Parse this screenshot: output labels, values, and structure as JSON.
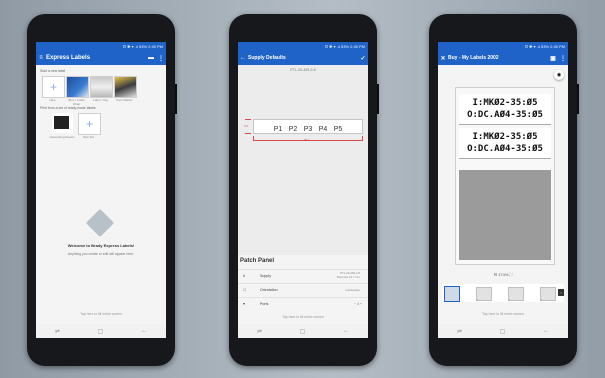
{
  "phone1": {
    "status": "⊡ ✱ ▾ .ıl 53% 2:45 PM",
    "title": "Express Labels",
    "start_new_label": "Start a new label",
    "templates": [
      "New",
      "Wire / Cable Wrap",
      "Label / Tag",
      "Pipe Marker"
    ],
    "print_from_set": "Print from a set of ready-made labels",
    "sets": [
      "Networking Panels",
      "New Set"
    ],
    "welcome_title": "Welcome to Brady Express Labels!",
    "welcome_body": "Anything you create or edit will appear here.",
    "footer_tip": "Tap here to fill entire screen"
  },
  "phone2": {
    "status": "⊡ ✱ ▾ .ıl 53% 2:45 PM",
    "title": "Supply Defaults",
    "part": "PTL-29-499-2-8",
    "patches": [
      "P1",
      "P2",
      "P3",
      "P4",
      "P5"
    ],
    "dim_width": "95.2",
    "dim_height": "4.5",
    "section_title": "Patch Panel",
    "rows": [
      {
        "icon": "#",
        "label": "Supply",
        "value": "PTL-29-499-2-8\nBold size 12.7 mm"
      },
      {
        "icon": "☐",
        "label": "Orientation",
        "value": "Landscape"
      },
      {
        "icon": "♥",
        "label": "Ports",
        "value": "4"
      }
    ],
    "footer_tip": "Tap here to fill entire screen"
  },
  "phone3": {
    "status": "⊡ ✱ ▾ .ıl 53% 2:45 PM",
    "title": "Buy - My Labels 2002",
    "label_lines": [
      "I:MKØ2-35:Ø5",
      "O:DC.AØ4-35:Ø5",
      "I:MKØ2-35:Ø5",
      "O:DC.AØ4-35:Ø5"
    ],
    "zoom": "174%",
    "thumbs": [
      "1",
      "2",
      "3",
      "4"
    ],
    "footer_tip": "Tap here to fill entire screen"
  },
  "colors": {
    "appbar": "#1f63c9",
    "accent_red": "#d84848",
    "brand": "#1f63c9"
  }
}
